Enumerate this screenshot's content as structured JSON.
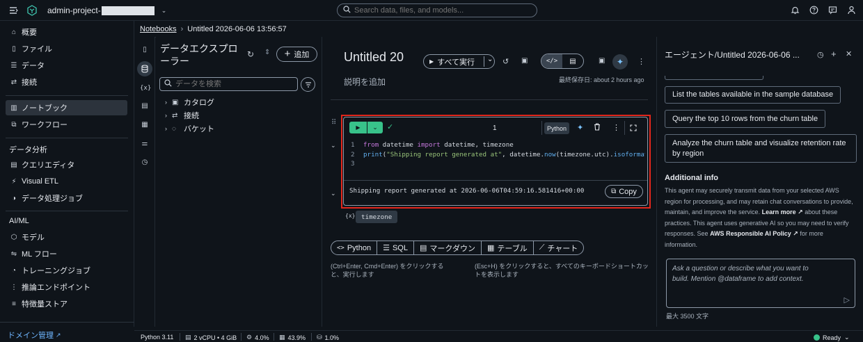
{
  "topbar": {
    "project_name": "admin-project-",
    "search_placeholder": "Search data, files, and models..."
  },
  "sidebar": {
    "items_top": [
      {
        "icon": "home-icon",
        "label": "概要"
      },
      {
        "icon": "file-icon",
        "label": "ファイル"
      },
      {
        "icon": "database-icon",
        "label": "データ"
      },
      {
        "icon": "connection-icon",
        "label": "接続"
      }
    ],
    "items_mid": [
      {
        "icon": "notebook-icon",
        "label": "ノートブック"
      },
      {
        "icon": "workflow-icon",
        "label": "ワークフロー"
      }
    ],
    "section_analytics": "データ分析",
    "items_analytics": [
      {
        "icon": "query-editor-icon",
        "label": "クエリエディタ"
      },
      {
        "icon": "visual-etl-icon",
        "label": "Visual ETL"
      },
      {
        "icon": "data-processing-icon",
        "label": "データ処理ジョブ"
      }
    ],
    "section_aiml": "AI/ML",
    "items_aiml": [
      {
        "icon": "model-icon",
        "label": "モデル"
      },
      {
        "icon": "ml-flow-icon",
        "label": "ML フロー"
      },
      {
        "icon": "training-icon",
        "label": "トレーニングジョブ"
      },
      {
        "icon": "endpoint-icon",
        "label": "推論エンドポイント"
      },
      {
        "icon": "feature-store-icon",
        "label": "特徴量ストア"
      }
    ],
    "domain_link": "ドメイン管理"
  },
  "breadcrumb": {
    "root": "Notebooks",
    "current": "Untitled 2026-06-06 13:56:57"
  },
  "explorer": {
    "title": "データエクスプローラー",
    "add_label": "追加",
    "search_placeholder": "データを検索",
    "tree": [
      {
        "icon": "catalog-icon",
        "label": "カタログ"
      },
      {
        "icon": "connection-icon",
        "label": "接続"
      },
      {
        "icon": "bucket-icon",
        "label": "バケット"
      }
    ]
  },
  "notebook": {
    "title": "Untitled 20",
    "description_placeholder": "説明を追加",
    "run_all_label": "すべて実行",
    "last_saved": "最終保存日: about 2 hours ago",
    "cell": {
      "exec_count": "1",
      "language": "Python",
      "code_lines": [
        {
          "no": "1",
          "parts": [
            [
              "kw",
              "from"
            ],
            [
              "plain",
              " datetime "
            ],
            [
              "kw",
              "import"
            ],
            [
              "plain",
              " datetime, timezone"
            ]
          ]
        },
        {
          "no": "2",
          "parts": [
            [
              "fn",
              "print"
            ],
            [
              "plain",
              "("
            ],
            [
              "str",
              "\"Shipping report generated at\""
            ],
            [
              "plain",
              ", datetime."
            ],
            [
              "fn",
              "now"
            ],
            [
              "plain",
              "(timezone.utc)."
            ],
            [
              "fn",
              "isoformat"
            ],
            [
              "plain",
              "("
            ]
          ]
        },
        {
          "no": "3",
          "parts": []
        }
      ],
      "output": "Shipping report generated at 2026-06-06T04:59:16.581416+00:00",
      "copy_label": "Copy"
    },
    "variable_tag": "timezone",
    "add_cell": {
      "python": "Python",
      "sql": "SQL",
      "markdown": "マークダウン",
      "table": "テーブル",
      "chart": "チャート"
    },
    "hint_run": "(Ctrl+Enter, Cmd+Enter) をクリックすると、実行します",
    "hint_shortcuts": "(Esc+H) をクリックすると、すべてのキーボードショートカットを表示します"
  },
  "agent": {
    "title": "エージェント/Untitled 2026-06-06 ...",
    "suggestions": [
      "List the tables available in the sample database",
      "Query the top 10 rows from the churn table",
      "Analyze the churn table and visualize retention rate by region"
    ],
    "info_title": "Additional info",
    "info_text_1": "This agent may securely transmit data from your selected AWS region for processing, and may retain chat conversations to provide, maintain, and improve the service.",
    "learn_more": "Learn more",
    "info_text_2": "about these practices. This agent uses generative AI so you may need to verify responses. See",
    "policy_link": "AWS Responsible AI Policy",
    "info_text_3": "for more information.",
    "input_placeholder": "Ask a question or describe what you want to build. Mention @dataframe to add context.",
    "char_limit": "最大 3500 文字"
  },
  "statusbar": {
    "kernel": "Python 3.11",
    "compute": "2 vCPU • 4 GiB",
    "cpu": "4.0%",
    "memory": "43.9%",
    "disk": "1.0%",
    "status": "Ready"
  }
}
